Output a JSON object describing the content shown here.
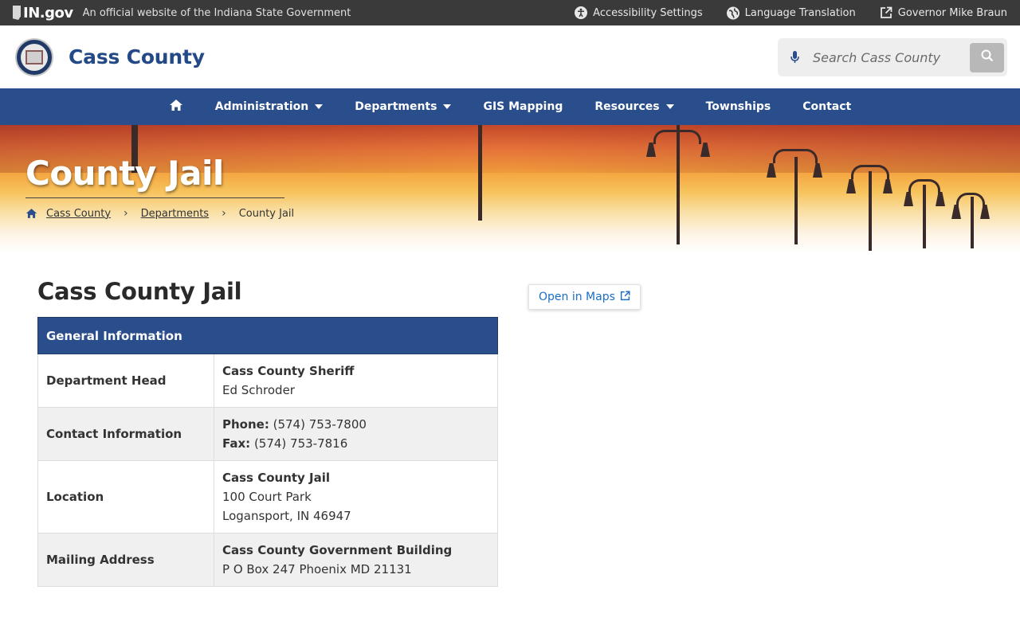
{
  "statebar": {
    "logo_text": "IN.gov",
    "official_text": "An official website of the Indiana State Government",
    "links": [
      {
        "label": "Accessibility Settings",
        "icon": "accessibility-icon"
      },
      {
        "label": "Language Translation",
        "icon": "globe-icon"
      },
      {
        "label": "Governor Mike Braun",
        "icon": "external-link-icon"
      }
    ]
  },
  "header": {
    "title": "Cass County",
    "search_placeholder": "Search Cass County"
  },
  "nav": {
    "items": [
      {
        "label": "Administration",
        "has_menu": true
      },
      {
        "label": "Departments",
        "has_menu": true
      },
      {
        "label": "GIS Mapping",
        "has_menu": false
      },
      {
        "label": "Resources",
        "has_menu": true
      },
      {
        "label": "Townships",
        "has_menu": false
      },
      {
        "label": "Contact",
        "has_menu": false
      }
    ]
  },
  "hero": {
    "title": "County Jail",
    "breadcrumbs": [
      "Cass County",
      "Departments",
      "County Jail"
    ]
  },
  "main": {
    "title": "Cass County Jail",
    "maps_button": "Open in Maps",
    "table": {
      "header": "General Information",
      "rows": [
        {
          "label": "Department Head",
          "lines": [
            {
              "bold": "Cass County Sheriff",
              "text": ""
            },
            {
              "bold": "",
              "text": "Ed Schroder"
            }
          ]
        },
        {
          "label": "Contact Information",
          "lines": [
            {
              "bold": "Phone:",
              "text": " (574) 753-7800"
            },
            {
              "bold": "Fax:",
              "text": " (574) 753-7816"
            }
          ]
        },
        {
          "label": "Location",
          "lines": [
            {
              "bold": "Cass County Jail",
              "text": ""
            },
            {
              "bold": "",
              "text": "100 Court Park"
            },
            {
              "bold": "",
              "text": "Logansport, IN 46947"
            }
          ]
        },
        {
          "label": "Mailing Address",
          "lines": [
            {
              "bold": "Cass County Government Building",
              "text": ""
            },
            {
              "bold": "",
              "text": "P O Box 247 Phoenix MD 21131"
            }
          ]
        }
      ]
    }
  },
  "colors": {
    "brand_blue": "#2a4e8c",
    "statebar": "#3a3a3a",
    "link_blue": "#1a6ec4"
  }
}
